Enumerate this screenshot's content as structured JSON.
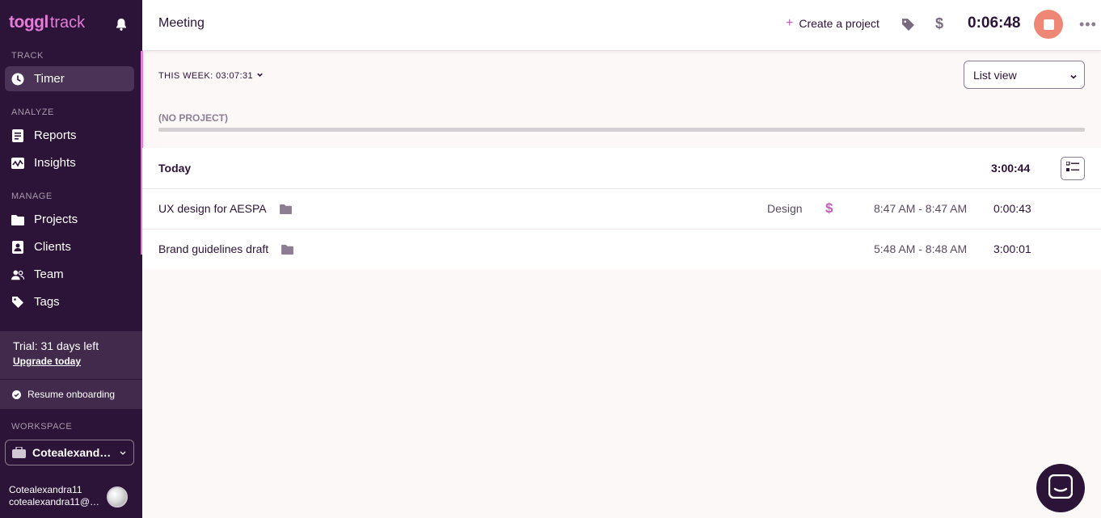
{
  "sidebar": {
    "logo_bold": "toggl",
    "logo_text": "track",
    "sections": {
      "track": "TRACK",
      "analyze": "ANALYZE",
      "manage": "MANAGE",
      "workspace": "WORKSPACE"
    },
    "items": {
      "timer": "Timer",
      "reports": "Reports",
      "insights": "Insights",
      "projects": "Projects",
      "clients": "Clients",
      "team": "Team",
      "tags": "Tags"
    },
    "trial": {
      "text": "Trial: 31 days left",
      "upgrade": "Upgrade today"
    },
    "resume_onboarding": "Resume onboarding",
    "workspace_name": "Cotealexandra11's workspace",
    "user": {
      "name": "Cotealexandra11",
      "email": "cotealexandra11@gmail.com"
    }
  },
  "topbar": {
    "description": "Meeting",
    "create_project": "Create a project",
    "timer": "0:06:48"
  },
  "main": {
    "week_label": "THIS WEEK: 03:07:31",
    "view_select": "List view",
    "no_project": "(NO PROJECT)",
    "group": {
      "label": "Today",
      "total": "3:00:44",
      "entries": [
        {
          "title": "UX design for AESPA",
          "tag": "Design",
          "billable": true,
          "range": "8:47 AM - 8:47 AM",
          "duration": "0:00:43"
        },
        {
          "title": "Brand guidelines draft",
          "tag": "",
          "billable": false,
          "range": "5:48 AM - 8:48 AM",
          "duration": "3:00:01"
        }
      ]
    }
  },
  "colors": {
    "sidebar_bg": "#2c1338",
    "accent": "#e57cd8",
    "stop_button": "#ee8776",
    "billable": "#c55bba"
  }
}
